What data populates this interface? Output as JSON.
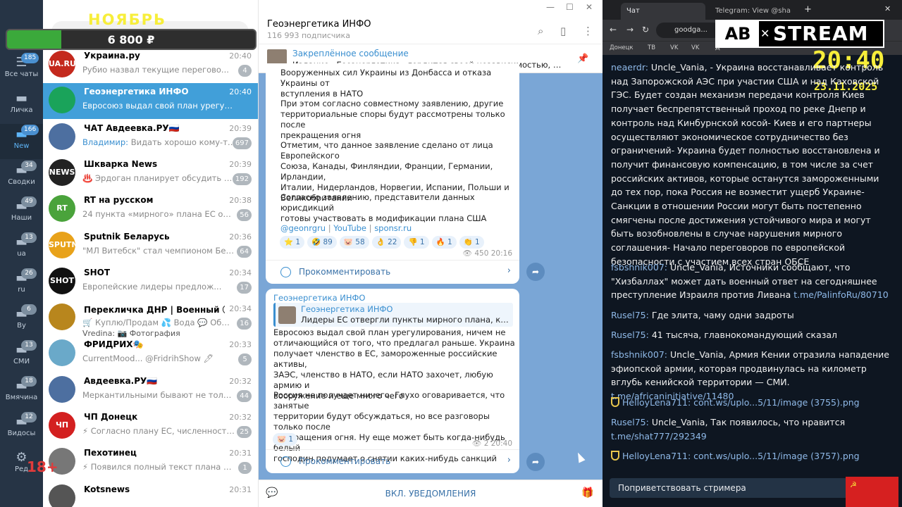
{
  "overlay": {
    "month": "НОЯБРЬ",
    "goal_amount": "6 800 ₽",
    "goal_progress": 0.22,
    "age_rating": "18+"
  },
  "rail": [
    {
      "label": "Все чаты",
      "badge": "185",
      "icon": "chats-icon"
    },
    {
      "label": "Личка",
      "badge": "",
      "icon": "folder-icon"
    },
    {
      "label": "New",
      "badge": "166",
      "icon": "folder-icon"
    },
    {
      "label": "Сводки",
      "badge": "34",
      "icon": "folder-icon"
    },
    {
      "label": "Наши",
      "badge": "49",
      "icon": "folder-icon"
    },
    {
      "label": "ua",
      "badge": "13",
      "icon": "folder-icon"
    },
    {
      "label": "ru",
      "badge": "26",
      "icon": "folder-icon"
    },
    {
      "label": "By",
      "badge": "6",
      "icon": "folder-icon"
    },
    {
      "label": "СМИ",
      "badge": "13",
      "icon": "folder-icon"
    },
    {
      "label": "Вмячина",
      "badge": "18",
      "icon": "folder-icon"
    },
    {
      "label": "Видосы",
      "badge": "12",
      "icon": "folder-icon"
    },
    {
      "label": "Ред",
      "badge": "",
      "icon": "edit-icon"
    }
  ],
  "chats": [
    {
      "name": "Украина.ру",
      "time": "20:40",
      "who": "",
      "preview": "Рубио назвал текущие перегово...",
      "count": "4",
      "avatar_text": "UA.RU",
      "avatar_color": "#c4291d"
    },
    {
      "name": "Геоэнергетика ИНФО",
      "time": "20:40",
      "who": "",
      "preview": "Евросоюз выдал свой план урегулирования,...",
      "count": "",
      "avatar_text": "",
      "avatar_color": "#1aa35a"
    },
    {
      "name": "ЧАТ Авдеевка.РУ🇷🇺",
      "time": "20:39",
      "who": "Владимир:",
      "preview": "Видать хорошо кому-то пел...",
      "count": "697",
      "avatar_text": "",
      "avatar_color": "#4d6fa0"
    },
    {
      "name": "Шкварка News",
      "time": "20:39",
      "who": "",
      "preview": "♨️ Эрдоган планирует обсудить с ...",
      "count": "192",
      "avatar_text": "NEWS",
      "avatar_color": "#222"
    },
    {
      "name": "RT на русском",
      "time": "20:38",
      "who": "",
      "preview": "24 пункта «мирного» плана ЕС опублик...",
      "count": "56",
      "avatar_text": "RT",
      "avatar_color": "#4aa33b"
    },
    {
      "name": "Sputnik Беларусь",
      "time": "20:36",
      "who": "",
      "preview": "\"МЛ Витебск\" стал чемпионом Бела...",
      "count": "64",
      "avatar_text": "SPUTNIK BY",
      "avatar_color": "#e8a21a"
    },
    {
      "name": "SHOT",
      "time": "20:34",
      "who": "",
      "preview": "Европейские лидеры предлож...",
      "count": "17",
      "avatar_text": "SHOT",
      "avatar_color": "#111"
    },
    {
      "name": "Перекличка ДНР | Военный Ⓩ До...",
      "time": "20:34",
      "who": "",
      "preview": "🛒 Куплю/Продам 💦 Вода 💬 Общ...",
      "count": "16",
      "avatar_text": "",
      "avatar_color": "#b8861d"
    },
    {
      "name": "ФРИДРИХ🎭",
      "time": "20:33",
      "who": "",
      "preview": "CurrentMood... @FridrihShow 🖊",
      "count": "5",
      "avatar_text": "",
      "avatar_color": "#6aa9c9"
    },
    {
      "name": "Авдеевка.РУ🇷🇺",
      "time": "20:32",
      "who": "",
      "preview": "Меркантильными бывают не только...",
      "count": "44",
      "avatar_text": "",
      "avatar_color": "#4d6fa0"
    },
    {
      "name": "ЧП Донецк",
      "time": "20:32",
      "who": "",
      "preview": "⚡ Согласно плану ЕС, численность ...",
      "count": "25",
      "avatar_text": "ЧП",
      "avatar_color": "#d32020"
    },
    {
      "name": "Пехотинец",
      "time": "20:31",
      "who": "",
      "preview": "⚡ Появился полный текст плана Евро...",
      "count": "1",
      "avatar_text": "",
      "avatar_color": "#777"
    },
    {
      "name": "Kotsnews",
      "time": "20:31",
      "who": "",
      "preview": "",
      "count": "",
      "avatar_text": "",
      "avatar_color": "#555"
    }
  ],
  "chat_extra_line": "Vredina: 📷 Фотография",
  "channel": {
    "title": "Геоэнергетика ИНФО",
    "subscribers": "116 993 подписчика",
    "pinned_title": "Закреплённое сообщение",
    "pinned_text": "Издание «Геоэнергетика» гордится своей независимостью, которая осн...",
    "bottom_label": "ВКЛ. УВЕДОМЛЕНИЯ"
  },
  "post1": {
    "lines_a": [
      "Вооруженных сил Украины из Донбасса и отказа Украины от",
      "вступления в НАТО"
    ],
    "lines_b": [
      "При этом согласно совместному заявлению, другие",
      "территориальные споры будут рассмотрены только после",
      "прекращения огня"
    ],
    "lines_c": [
      "Отметим, что данное заявление сделано от лица Европейского",
      "Союза, Канады, Финляндии, Франции, Германии, Ирландии,",
      "Италии, Нидерландов, Норвегии, Испании, Польши и",
      "Великобритании"
    ],
    "lines_d": [
      "Согласно заявлению, представители данных юрисдикций",
      "готовы участвовать в модификации плана США"
    ],
    "link1": "@geonrgru",
    "link2": "YouTube",
    "link3": "sponsr.ru",
    "reactions": [
      "⭐ 1",
      "🤣 89",
      "🐷 58",
      "👌 22",
      "👎 1",
      "🔥 1",
      "👏 1"
    ],
    "views": "450",
    "time": "20:16",
    "comment_label": "Прокомментировать"
  },
  "post2": {
    "author": "Геоэнергетика ИНФО",
    "quote_title": "Геоэнергетика ИНФО",
    "quote_text": "Лидеры ЕС отвергли пункты мирного плана, касающие...",
    "lines_a": [
      "Евросоюз выдал свой план урегулирования, ничем не",
      "отличающийся от того, что предлагал раньше. Украина",
      "получает членство в ЕС, замороженные российские активы,",
      "ЗАЭС, членство в НАТО, если НАТО захочет, любую армию и",
      "вооружение и еще много чего"
    ],
    "lines_b": [
      "Россия не получает ничего. Глухо оговаривается, что занятые",
      "территории будут обсуждаться, но все разговоры только после",
      "прекращения огня. Ну еще может быть когда-нибудь белый",
      "господин подумает о снятии каких-нибудь санкций"
    ],
    "reaction": "🐷 1",
    "views": "2",
    "time": "20:40",
    "comment_label": "Прокомментировать"
  },
  "browser": {
    "tab1": "Чат",
    "tab2": "Telegram: View @sha",
    "url": "goodga...",
    "bookmarks": [
      "Донецк",
      "ТВ",
      "VK",
      "VK",
      "Д"
    ],
    "logo_left": "AB",
    "logo_right": "STREAM",
    "clock": "20:40",
    "date": "23.11.2025",
    "greet": "Поприветствовать стримера"
  },
  "stream_chat": [
    {
      "user": "neaerdr:",
      "text": " Uncle_Vania, - Украина восстанавливает контроль над Запорожской АЭС при участии США и над Каховской ГЭС. Будет создан механизм передачи контроля Киев получает беспрепятственный проход по реке Днепр и контроль над Кинбурнской косой- Киев и его партнеры осуществляют экономическое сотрудничество без ограничений- Украина будет полностью восстановлена и получит финансовую компенсацию, в том числе за счет российских активов, которые останутся замороженными до тех пор, пока Россия не возместит ущерб Украине- Санкции в отношении России могут быть постепенно смягчены после достижения устойчивого мира и могут быть возобновлены в случае нарушения мирного соглашения- Начало переговоров по европейской безопасности с участием всех стран ОБСЕ",
      "link": "",
      "badge": false
    },
    {
      "user": "fsbshnik007:",
      "text": " Uncle_Vania, Источники сообщают, что \"Хизбаллах\" может дать военный ответ на сегодняшнее преступление Израиля против Ливана ",
      "link": "t.me/PalinfoRu/80710",
      "badge": false
    },
    {
      "user": "Rusel75:",
      "text": " Где элита, чаму одни задроты",
      "link": "",
      "badge": false
    },
    {
      "user": "Rusel75:",
      "text": " 41 тысяча, главнокомандующий сказал",
      "link": "",
      "badge": false
    },
    {
      "user": "fsbshnik007:",
      "text": " Uncle_Vania, Армия Кении отразила нападение эфиопской армии, которая продвинулась на километр вглубь кенийской территории — СМИ. ",
      "link": "t.me/africaninitiative/11480",
      "badge": false
    },
    {
      "user": "HelloyLena711:",
      "text": " ",
      "link": "cont.ws/uplo...5/11/image (3755).png",
      "badge": true
    },
    {
      "user": "Rusel75:",
      "text": " Uncle_Vania, Так появилось, что нравится ",
      "link": "t.me/shat777/292349",
      "badge": false
    },
    {
      "user": "HelloyLena711:",
      "text": " ",
      "link": "cont.ws/uplo...5/11/image (3757).png",
      "badge": true
    }
  ]
}
